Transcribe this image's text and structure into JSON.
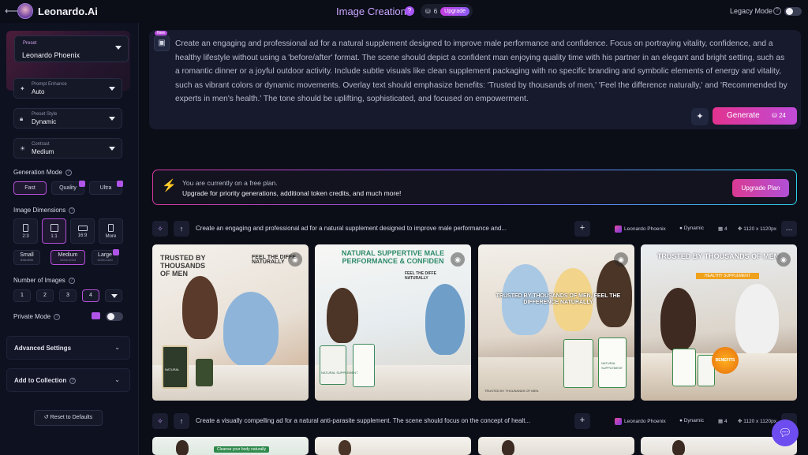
{
  "app": {
    "brand": "Leonardo.Ai",
    "page_title": "Image Creation",
    "token_count": "6",
    "upgrade_label": "Upgrade",
    "legacy_mode_label": "Legacy Mode"
  },
  "sidebar": {
    "preset": {
      "label": "Preset",
      "value": "Leonardo Phoenix"
    },
    "prompt_enhance": {
      "label": "Prompt Enhance",
      "value": "Auto"
    },
    "preset_style": {
      "label": "Preset Style",
      "value": "Dynamic"
    },
    "contrast": {
      "label": "Contrast",
      "value": "Medium"
    },
    "generation_mode": {
      "label": "Generation Mode",
      "options": [
        "Fast",
        "Quality",
        "Ultra"
      ],
      "selected": "Fast"
    },
    "image_dimensions": {
      "label": "Image Dimensions",
      "ratios": [
        "2:3",
        "1:1",
        "16:9",
        "More"
      ],
      "selected_ratio": "1:1",
      "sizes": [
        {
          "name": "Small",
          "px": "896×896"
        },
        {
          "name": "Medium",
          "px": "1024×1024"
        },
        {
          "name": "Large",
          "px": "1120×1120"
        }
      ],
      "selected_size": "Medium"
    },
    "number_of_images": {
      "label": "Number of Images",
      "options": [
        "1",
        "2",
        "3",
        "4"
      ],
      "selected": "4"
    },
    "private_mode": {
      "label": "Private Mode",
      "on": false
    },
    "advanced_settings": "Advanced Settings",
    "add_to_collection": "Add to Collection",
    "reset": "Reset to Defaults"
  },
  "prompt": {
    "new_badge": "New",
    "text": "Create an engaging and professional ad for a natural supplement designed to improve male performance and confidence. Focus on portraying vitality, confidence, and a healthy lifestyle without using a 'before/after' format. The scene should depict a confident man enjoying quality time with his partner in an elegant and bright setting, such as a romantic dinner or a joyful outdoor activity. Include subtle visuals like clean supplement packaging with no specific branding and symbolic elements of energy and vitality, such as vibrant colors or dynamic movements. Overlay text should emphasize benefits: 'Trusted by thousands of men,' 'Feel the difference naturally,' and 'Recommended by experts in men's health.' The tone should be uplifting, sophisticated, and focused on empowerment.",
    "generate_label": "Generate",
    "generate_cost": "24"
  },
  "banner": {
    "line1": "You are currently on a free plan.",
    "line2": "Upgrade for priority generations, additional token credits, and much more!",
    "button": "Upgrade Plan"
  },
  "generations": [
    {
      "prompt": "Create an engaging and professional ad for a natural supplement designed to improve male performance and...",
      "model": "Leonardo Phoenix",
      "style": "Dynamic",
      "count": "4",
      "size": "1120 x 1120px",
      "images": [
        {
          "headline": "TRUSTED BY THOUSANDS OF MEN",
          "side": "FEEL THE DIFFE NATURALLY",
          "label": "NATURAL"
        },
        {
          "headline": "NATURAL SUPPERTIVE MALE PERFORMANCE & CONFIDEN",
          "side": "FEEL THE DIFFE NATURALLY",
          "label": "NATURAL SUPPLEMENT"
        },
        {
          "headline": "TRUSTED BY THOUSANDS OF MEN, FEEL THE DIFFERENCE NATURALLY",
          "side": "TRUSTED BY THOUSANDS OF MEN.",
          "label": "NATURAL SUPPLEMENT"
        },
        {
          "headline": "TRUSTED BY THOUSANDS OF MEN",
          "side": "HEALTHY SUPPLEMENT",
          "label": "BENEFITS"
        }
      ]
    },
    {
      "prompt": "Create a visually compelling ad for a natural anti-parasite supplement. The scene should focus on the concept of healt...",
      "model": "Leonardo Phoenix",
      "style": "Dynamic",
      "count": "4",
      "size": "1120 x 1120px",
      "images": [
        {
          "headline": "Cleanse your body naturally"
        }
      ]
    }
  ],
  "colors": {
    "accent": "#b44fd9",
    "generate": "#e2338f",
    "bg": "#0b0d17"
  }
}
